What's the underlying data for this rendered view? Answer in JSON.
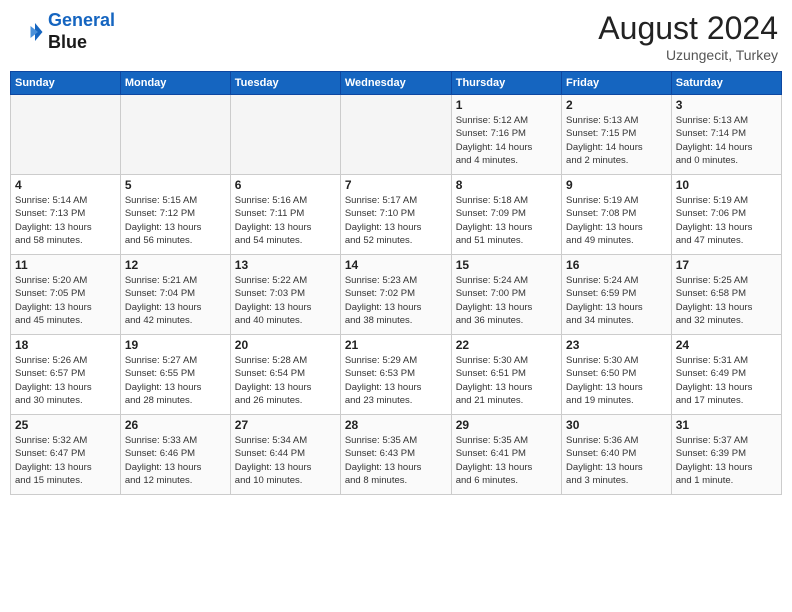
{
  "header": {
    "logo_line1": "General",
    "logo_line2": "Blue",
    "month_year": "August 2024",
    "location": "Uzungecit, Turkey"
  },
  "days_of_week": [
    "Sunday",
    "Monday",
    "Tuesday",
    "Wednesday",
    "Thursday",
    "Friday",
    "Saturday"
  ],
  "weeks": [
    [
      {
        "day": "",
        "info": ""
      },
      {
        "day": "",
        "info": ""
      },
      {
        "day": "",
        "info": ""
      },
      {
        "day": "",
        "info": ""
      },
      {
        "day": "1",
        "info": "Sunrise: 5:12 AM\nSunset: 7:16 PM\nDaylight: 14 hours\nand 4 minutes."
      },
      {
        "day": "2",
        "info": "Sunrise: 5:13 AM\nSunset: 7:15 PM\nDaylight: 14 hours\nand 2 minutes."
      },
      {
        "day": "3",
        "info": "Sunrise: 5:13 AM\nSunset: 7:14 PM\nDaylight: 14 hours\nand 0 minutes."
      }
    ],
    [
      {
        "day": "4",
        "info": "Sunrise: 5:14 AM\nSunset: 7:13 PM\nDaylight: 13 hours\nand 58 minutes."
      },
      {
        "day": "5",
        "info": "Sunrise: 5:15 AM\nSunset: 7:12 PM\nDaylight: 13 hours\nand 56 minutes."
      },
      {
        "day": "6",
        "info": "Sunrise: 5:16 AM\nSunset: 7:11 PM\nDaylight: 13 hours\nand 54 minutes."
      },
      {
        "day": "7",
        "info": "Sunrise: 5:17 AM\nSunset: 7:10 PM\nDaylight: 13 hours\nand 52 minutes."
      },
      {
        "day": "8",
        "info": "Sunrise: 5:18 AM\nSunset: 7:09 PM\nDaylight: 13 hours\nand 51 minutes."
      },
      {
        "day": "9",
        "info": "Sunrise: 5:19 AM\nSunset: 7:08 PM\nDaylight: 13 hours\nand 49 minutes."
      },
      {
        "day": "10",
        "info": "Sunrise: 5:19 AM\nSunset: 7:06 PM\nDaylight: 13 hours\nand 47 minutes."
      }
    ],
    [
      {
        "day": "11",
        "info": "Sunrise: 5:20 AM\nSunset: 7:05 PM\nDaylight: 13 hours\nand 45 minutes."
      },
      {
        "day": "12",
        "info": "Sunrise: 5:21 AM\nSunset: 7:04 PM\nDaylight: 13 hours\nand 42 minutes."
      },
      {
        "day": "13",
        "info": "Sunrise: 5:22 AM\nSunset: 7:03 PM\nDaylight: 13 hours\nand 40 minutes."
      },
      {
        "day": "14",
        "info": "Sunrise: 5:23 AM\nSunset: 7:02 PM\nDaylight: 13 hours\nand 38 minutes."
      },
      {
        "day": "15",
        "info": "Sunrise: 5:24 AM\nSunset: 7:00 PM\nDaylight: 13 hours\nand 36 minutes."
      },
      {
        "day": "16",
        "info": "Sunrise: 5:24 AM\nSunset: 6:59 PM\nDaylight: 13 hours\nand 34 minutes."
      },
      {
        "day": "17",
        "info": "Sunrise: 5:25 AM\nSunset: 6:58 PM\nDaylight: 13 hours\nand 32 minutes."
      }
    ],
    [
      {
        "day": "18",
        "info": "Sunrise: 5:26 AM\nSunset: 6:57 PM\nDaylight: 13 hours\nand 30 minutes."
      },
      {
        "day": "19",
        "info": "Sunrise: 5:27 AM\nSunset: 6:55 PM\nDaylight: 13 hours\nand 28 minutes."
      },
      {
        "day": "20",
        "info": "Sunrise: 5:28 AM\nSunset: 6:54 PM\nDaylight: 13 hours\nand 26 minutes."
      },
      {
        "day": "21",
        "info": "Sunrise: 5:29 AM\nSunset: 6:53 PM\nDaylight: 13 hours\nand 23 minutes."
      },
      {
        "day": "22",
        "info": "Sunrise: 5:30 AM\nSunset: 6:51 PM\nDaylight: 13 hours\nand 21 minutes."
      },
      {
        "day": "23",
        "info": "Sunrise: 5:30 AM\nSunset: 6:50 PM\nDaylight: 13 hours\nand 19 minutes."
      },
      {
        "day": "24",
        "info": "Sunrise: 5:31 AM\nSunset: 6:49 PM\nDaylight: 13 hours\nand 17 minutes."
      }
    ],
    [
      {
        "day": "25",
        "info": "Sunrise: 5:32 AM\nSunset: 6:47 PM\nDaylight: 13 hours\nand 15 minutes."
      },
      {
        "day": "26",
        "info": "Sunrise: 5:33 AM\nSunset: 6:46 PM\nDaylight: 13 hours\nand 12 minutes."
      },
      {
        "day": "27",
        "info": "Sunrise: 5:34 AM\nSunset: 6:44 PM\nDaylight: 13 hours\nand 10 minutes."
      },
      {
        "day": "28",
        "info": "Sunrise: 5:35 AM\nSunset: 6:43 PM\nDaylight: 13 hours\nand 8 minutes."
      },
      {
        "day": "29",
        "info": "Sunrise: 5:35 AM\nSunset: 6:41 PM\nDaylight: 13 hours\nand 6 minutes."
      },
      {
        "day": "30",
        "info": "Sunrise: 5:36 AM\nSunset: 6:40 PM\nDaylight: 13 hours\nand 3 minutes."
      },
      {
        "day": "31",
        "info": "Sunrise: 5:37 AM\nSunset: 6:39 PM\nDaylight: 13 hours\nand 1 minute."
      }
    ]
  ]
}
